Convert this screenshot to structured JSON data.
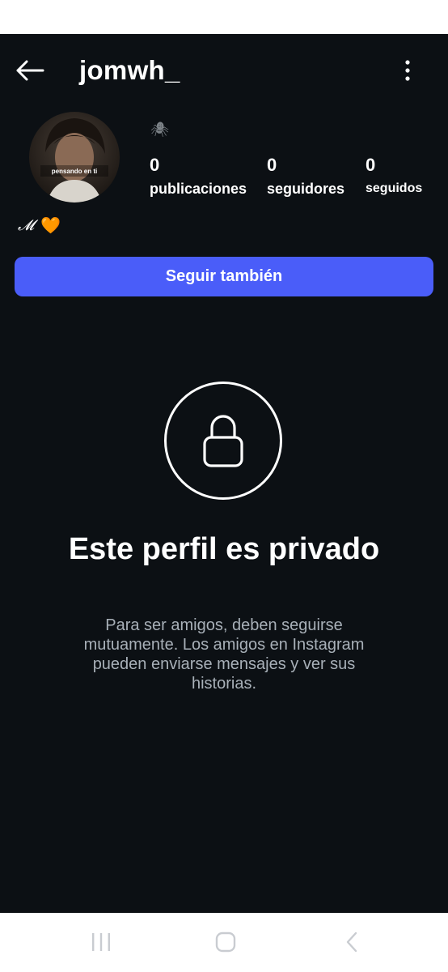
{
  "profile": {
    "username": "jomwh_",
    "avatar_caption": "pensando en ti",
    "note_icon": "spider-icon",
    "bio_letter": "𝓜",
    "bio_emoji": "🧡"
  },
  "stats": [
    {
      "value": "0",
      "label": "publicaciones"
    },
    {
      "value": "0",
      "label": "seguidores"
    },
    {
      "value": "0",
      "label": "seguidos"
    }
  ],
  "actions": {
    "follow_label": "Seguir también"
  },
  "private": {
    "title": "Este perfil es privado",
    "description": "Para ser amigos, deben seguirse mutuamente. Los amigos en Instagram pueden enviarse mensajes y ver sus historias."
  },
  "colors": {
    "background": "#0c1014",
    "button": "#4a5df9",
    "text": "#ffffff",
    "muted_text": "#a8b0b8"
  }
}
